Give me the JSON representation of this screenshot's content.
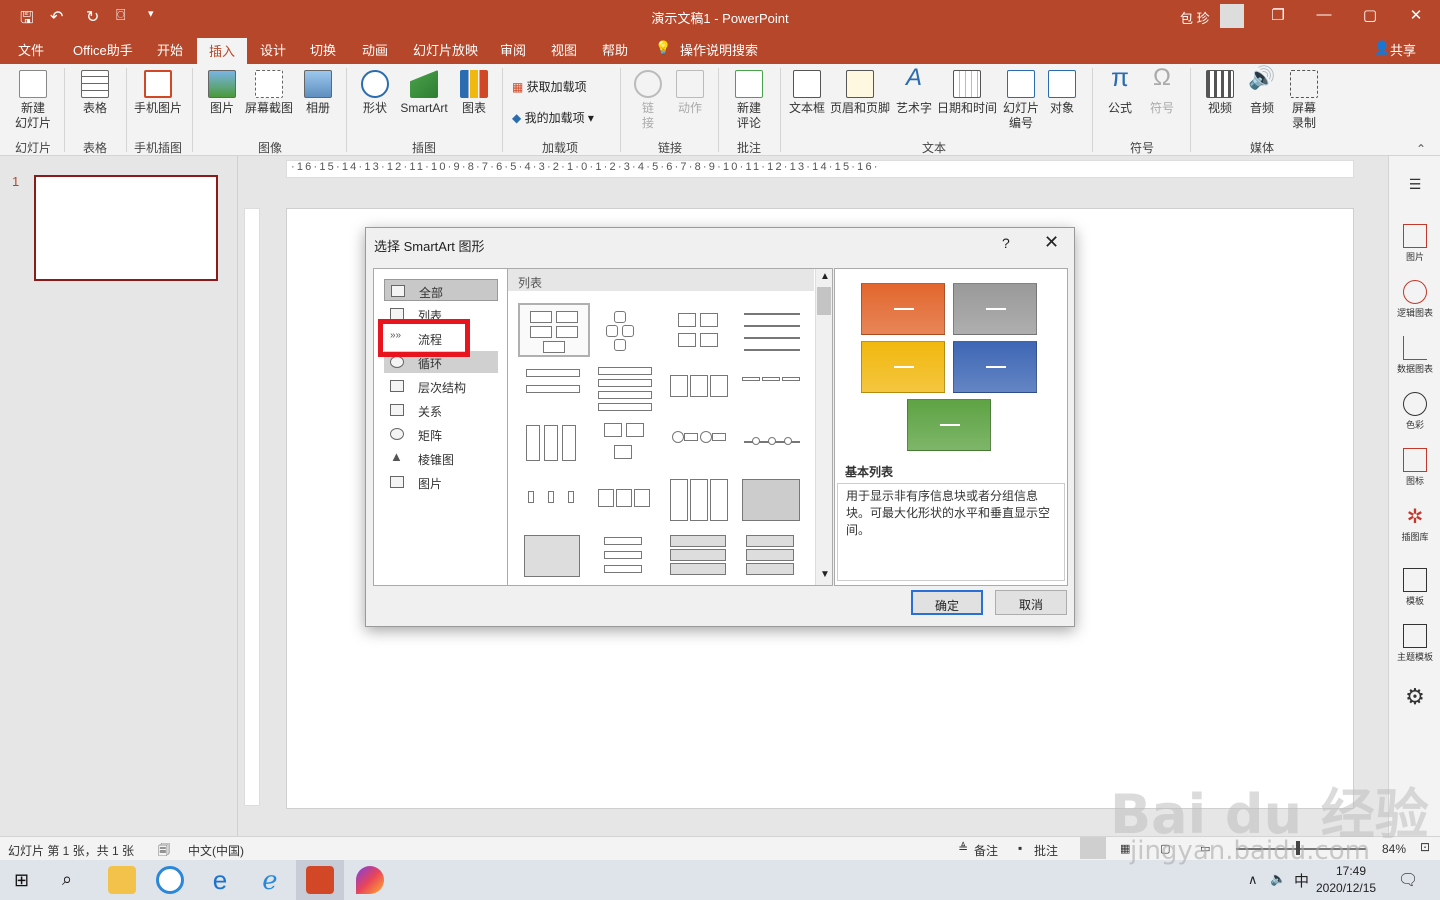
{
  "titlebar": {
    "title": "演示文稿1  -  PowerPoint",
    "user": "包 珍",
    "restore_glyph": "❐",
    "minimize_glyph": "—",
    "maximize_glyph": "▢",
    "close_glyph": "✕"
  },
  "menu": {
    "tabs": [
      "文件",
      "Office助手",
      "开始",
      "插入",
      "设计",
      "切换",
      "动画",
      "幻灯片放映",
      "审阅",
      "视图",
      "帮助"
    ],
    "active": "插入",
    "search": "操作说明搜索",
    "share": "共享"
  },
  "ribbon": {
    "buttons": {
      "new_slide": "新建\n幻灯片",
      "table": "表格",
      "phone_image": "手机图片",
      "picture": "图片",
      "screenshot": "屏幕截图",
      "album": "相册",
      "shapes": "形状",
      "smartart": "SmartArt",
      "chart": "图表",
      "get_addins": "获取加载项",
      "my_addins": "我的加载项",
      "link": "链\n接",
      "action": "动作",
      "new_comment": "新建\n评论",
      "textbox": "文本框",
      "header_footer": "页眉和页脚",
      "wordart": "艺术字",
      "datetime": "日期和时间",
      "slide_number": "幻灯片\n编号",
      "object": "对象",
      "equation": "公式",
      "symbol": "符号",
      "video": "视频",
      "audio": "音频",
      "screen_record": "屏幕\n录制"
    },
    "groups": {
      "slides": "幻灯片",
      "table": "表格",
      "phone": "手机插图",
      "images": "图像",
      "illustrations": "插图",
      "addins": "加载项",
      "links": "链接",
      "comments": "批注",
      "text": "文本",
      "symbols": "符号",
      "media": "媒体"
    }
  },
  "slides_pane": {
    "number": "1"
  },
  "ruler": {
    "labels": "·16·15·14·13·12·11·10·9·8·7·6·5·4·3·2·1·0·1·2·3·4·5·6·7·8·9·10·11·12·13·14·15·16·"
  },
  "task_pane": {
    "items": [
      "图片",
      "逻辑图表",
      "数据图表",
      "色彩",
      "图标",
      "插图库",
      "模板",
      "主题模板"
    ]
  },
  "dialog": {
    "title": "选择 SmartArt 图形",
    "help": "?",
    "close": "✕",
    "categories": [
      "全部",
      "列表",
      "流程",
      "循环",
      "层次结构",
      "关系",
      "矩阵",
      "棱锥图",
      "图片"
    ],
    "selected_category": "全部",
    "gallery_header": "列表",
    "preview": {
      "name": "基本列表",
      "description": "用于显示非有序信息块或者分组信息块。可最大化形状的水平和垂直显示空间。",
      "colors": [
        "#e2672e",
        "#9a9a9a",
        "#f1b80f",
        "#3e67b5",
        "#5ea344"
      ],
      "dash": "—"
    },
    "ok": "确定",
    "cancel": "取消"
  },
  "statusbar": {
    "slide_info": "幻灯片 第 1 张，共 1 张",
    "language": "中文(中国)",
    "notes": "备注",
    "comments": "批注",
    "zoom": "84%"
  },
  "taskbar": {
    "time": "17:49",
    "date": "2020/12/15",
    "ime": "中"
  },
  "watermark": {
    "brand": "Bai du 经验",
    "url": "jingyan.baidu.com"
  }
}
